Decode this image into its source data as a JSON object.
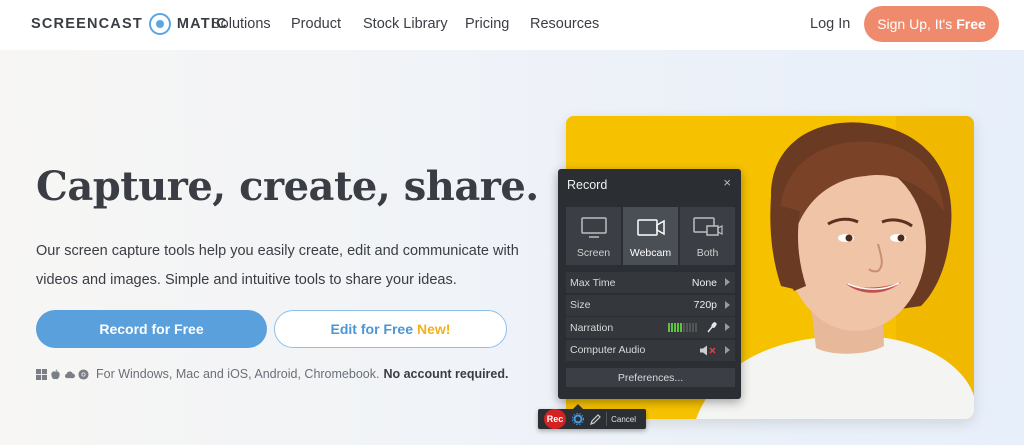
{
  "nav": {
    "logo_left": "SCREENCAST",
    "logo_right": "MATIC",
    "items": [
      "Solutions",
      "Product",
      "Stock Library",
      "Pricing",
      "Resources"
    ],
    "login": "Log In",
    "signup_prefix": "Sign Up, It's",
    "signup_bold": "Free"
  },
  "hero": {
    "headline": "Capture, create, share.",
    "subtext": "Our screen capture tools help you easily create, edit and communicate with videos and images. Simple and intuitive tools to share your ideas.",
    "record_button": "Record for Free",
    "edit_button": "Edit for Free",
    "edit_badge": "New!",
    "platforms_text": "For Windows, Mac and iOS, Android, Chromebook.",
    "platforms_bold": "No account required."
  },
  "recorder": {
    "title": "Record",
    "close": "×",
    "modes": [
      "Screen",
      "Webcam",
      "Both"
    ],
    "active_mode": "Webcam",
    "rows": [
      {
        "label": "Max Time",
        "value": "None"
      },
      {
        "label": "Size",
        "value": "720p"
      },
      {
        "label": "Narration",
        "value": ""
      },
      {
        "label": "Computer Audio",
        "value": ""
      }
    ],
    "preferences": "Preferences...",
    "toolbar_rec": "Rec",
    "toolbar_cancel": "Cancel"
  },
  "colors": {
    "accent_blue": "#5aa0dc",
    "signup_orange": "#f08a6c",
    "photo_yellow": "#f6c200",
    "new_badge": "#f2b21e"
  }
}
